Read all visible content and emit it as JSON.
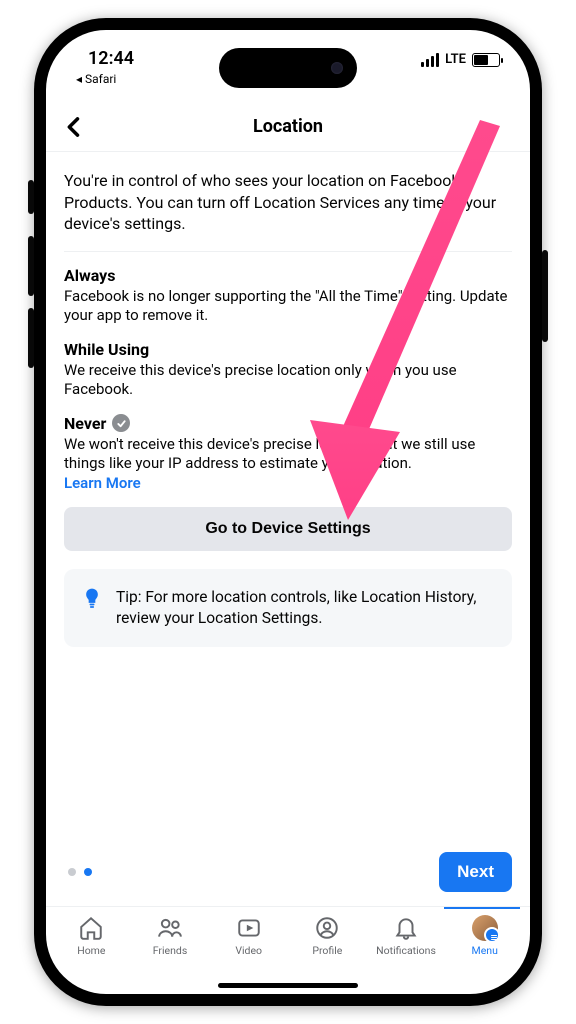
{
  "status": {
    "time": "12:44",
    "back_app_label": "◂ Safari",
    "network_label": "LTE"
  },
  "header": {
    "title": "Location"
  },
  "intro": "You're in control of who sees your location on Facebook Products. You can turn off Location Services any time in your device's settings.",
  "options": {
    "always": {
      "title": "Always",
      "desc": "Facebook is no longer supporting the \"All the Time\" setting. Update your app to remove it."
    },
    "while_using": {
      "title": "While Using",
      "desc": "We receive this device's precise location only when you use Facebook."
    },
    "never": {
      "title": "Never",
      "desc": "We won't receive this device's precise location, but we still use things like your IP address to estimate your location.",
      "learn_more": "Learn More"
    }
  },
  "device_button": "Go to Device Settings",
  "tip": "Tip: For more location controls, like Location History, review your Location Settings.",
  "next_button": "Next",
  "pager": {
    "total": 2,
    "active_index": 1
  },
  "tabs": {
    "home": "Home",
    "friends": "Friends",
    "video": "Video",
    "profile": "Profile",
    "notifications": "Notifications",
    "menu": "Menu"
  },
  "colors": {
    "accent": "#1877f2",
    "annotation_arrow": "#ff4a8d"
  }
}
